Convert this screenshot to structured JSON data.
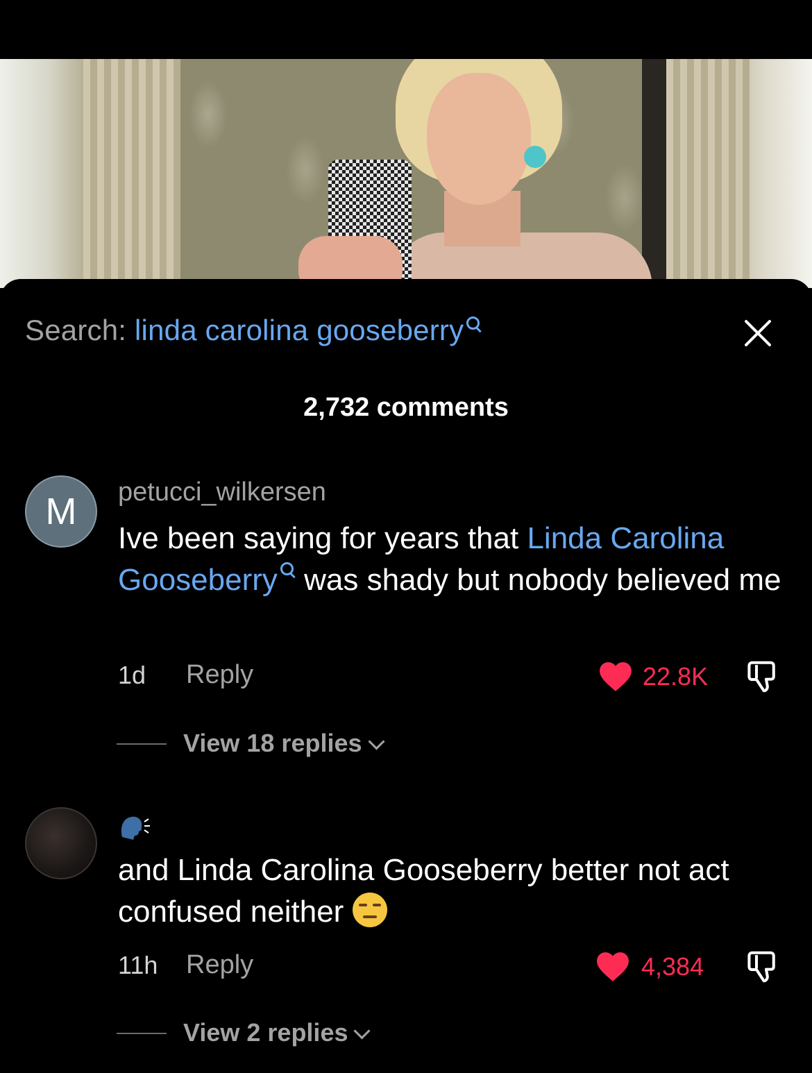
{
  "search": {
    "prefix": "Search:",
    "query": "linda carolina gooseberry"
  },
  "comments_count": "2,732 comments",
  "comments": [
    {
      "avatar_letter": "M",
      "username": "petucci_wilkersen",
      "text_before": "Ive been saying for years that ",
      "text_link": "Linda Carolina Gooseberry",
      "text_after": " was shady but nobody believed me",
      "time": "1d",
      "reply_label": "Reply",
      "likes": "22.8K",
      "view_replies": "View 18 replies"
    },
    {
      "username_icon": "speaking-head-icon",
      "text": "and Linda Carolina Gooseberry better not act confused neither",
      "emoji": "unamused-face-emoji",
      "time": "11h",
      "reply_label": "Reply",
      "likes": "4,384",
      "view_replies": "View 2 replies"
    }
  ],
  "colors": {
    "link": "#68a8f0",
    "like": "#fe2c55",
    "muted": "#a3a3a3",
    "background": "#000000"
  }
}
